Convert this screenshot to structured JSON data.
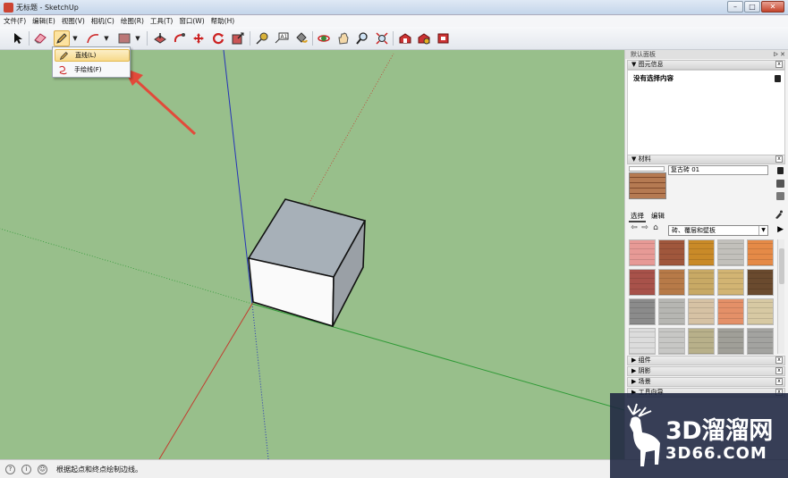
{
  "window": {
    "title": "无标题 - SketchUp",
    "controls": [
      "–",
      "□",
      "✕"
    ]
  },
  "menubar": {
    "items": [
      "文件(F)",
      "编辑(E)",
      "视图(V)",
      "相机(C)",
      "绘图(R)",
      "工具(T)",
      "窗口(W)",
      "帮助(H)"
    ]
  },
  "toolbar": {
    "tools": [
      "select-icon",
      "eraser-icon",
      "pencil-icon",
      "arc-icon",
      "rectangle-icon",
      "pushpull-icon",
      "followme-icon",
      "move-icon",
      "rotate-icon",
      "scale-icon",
      "tape-measure-icon",
      "text-icon",
      "paint-bucket-icon",
      "orbit-icon",
      "pan-icon",
      "zoom-icon",
      "zoom-extents-icon",
      "warehouse-icon",
      "share-model-icon",
      "extension-icon"
    ],
    "active_tool": "pencil-icon"
  },
  "draw_menu": {
    "items": [
      {
        "label": "直线(L)",
        "icon": "pencil-icon",
        "highlighted": true
      },
      {
        "label": "手绘线(F)",
        "icon": "freehand-icon",
        "highlighted": false
      }
    ]
  },
  "statusbar": {
    "message": "根据起点和终点绘制边线。"
  },
  "tray": {
    "title": "默认面板",
    "entity_info": {
      "header": "图元信息",
      "status": "没有选择内容"
    },
    "materials": {
      "header": "材料",
      "current_name": "复古砖 01",
      "tab_select": "选择",
      "tab_edit": "编辑",
      "library": "砖、覆层和壁板",
      "swatch_colors": [
        "#e79a96",
        "#a0573c",
        "#c98a28",
        "#c2c0bb",
        "#e58a47",
        "#a8524a",
        "#b77a48",
        "#c8a965",
        "#d2b473",
        "#6a4a2e",
        "#8b8b8b",
        "#b6b6b2",
        "#d6c2a4",
        "#e49068",
        "#d7c9a3",
        "#dcdcdc",
        "#c7c7c5",
        "#b8b08a",
        "#a09f98",
        "#a3a3a0"
      ]
    },
    "collapsed_panels": [
      "组件",
      "阴影",
      "场景",
      "工具向导"
    ]
  },
  "viewport": {
    "background_color": "#98bf8b",
    "axis_colors": {
      "red": "#c23b2e",
      "green": "#2f9a36",
      "blue": "#2433b8"
    },
    "box_colors": {
      "top": "#a7b0b8",
      "left_face": "#fafafa",
      "right_face": "#9aa0a6"
    }
  },
  "watermark": {
    "text": "3D溜溜网",
    "url_text": "3D66.COM"
  }
}
